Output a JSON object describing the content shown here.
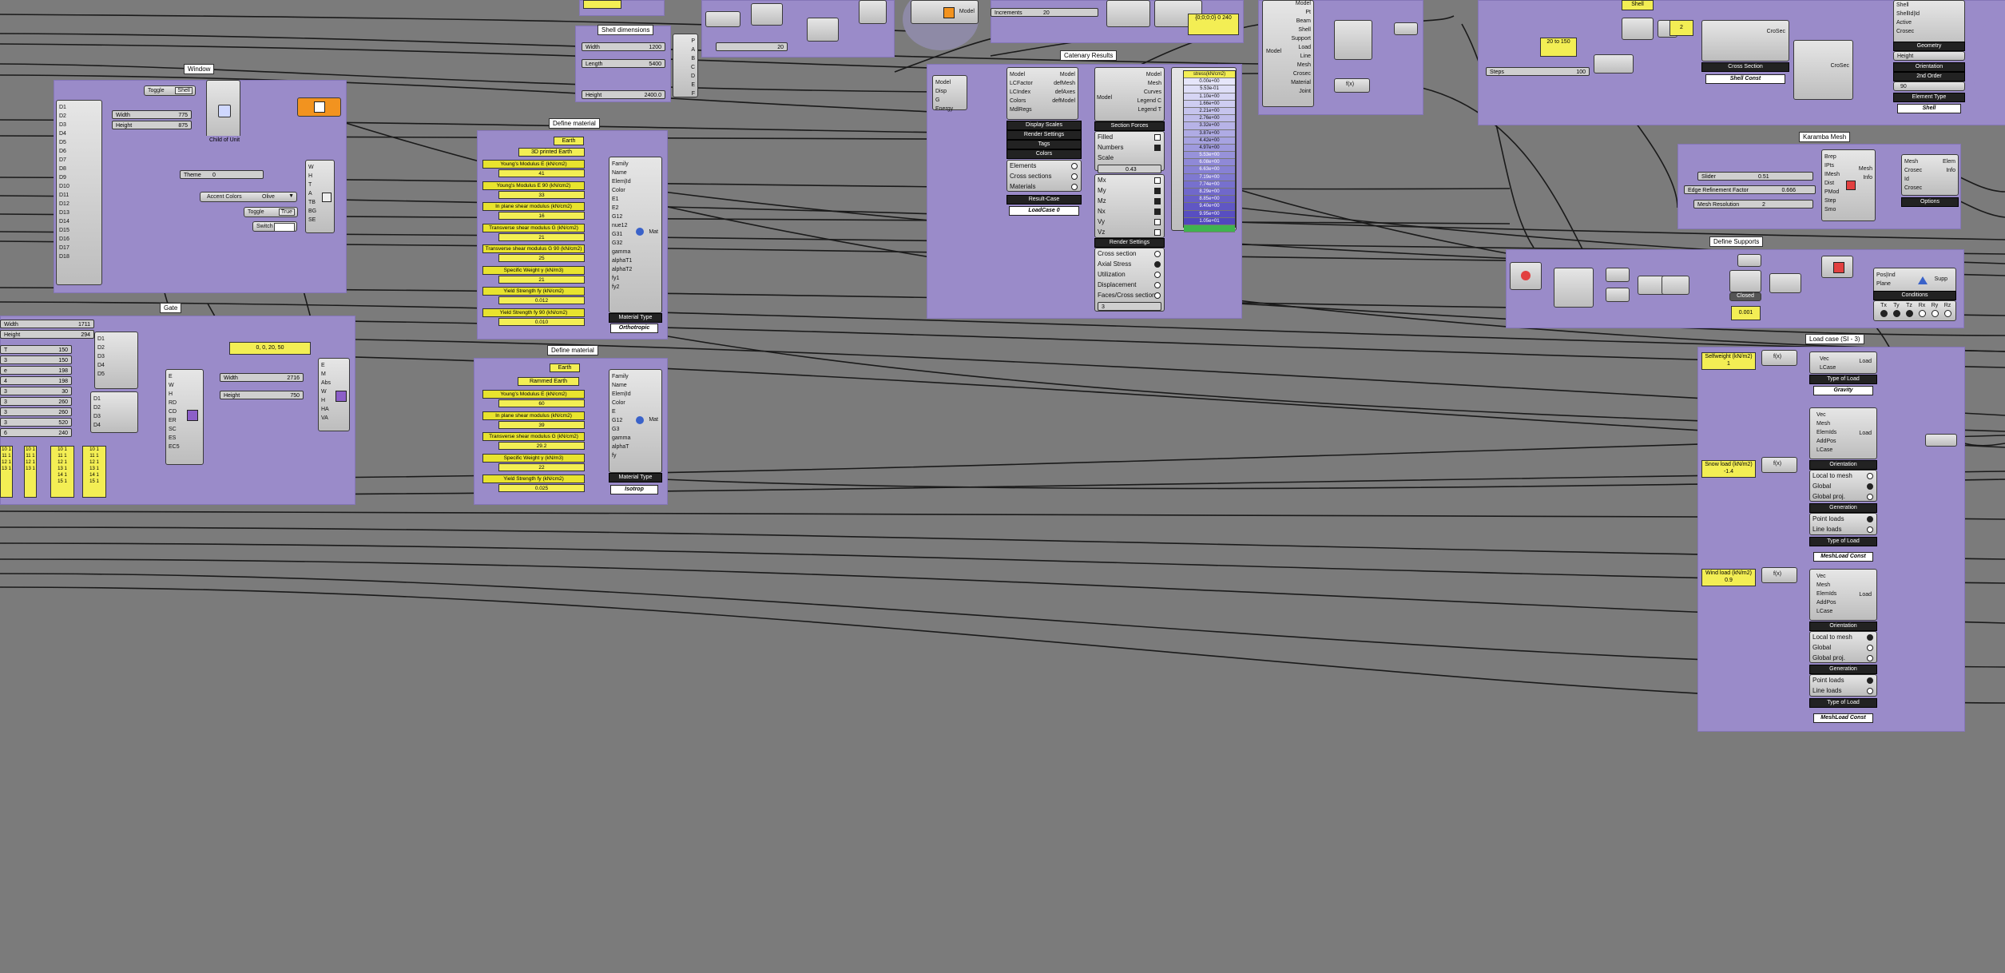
{
  "groups": {
    "window": "Window",
    "define_material_1": "Define material",
    "define_material_2": "Define material",
    "catenary_results": "Catenary Results",
    "karamba_mesh": "Karamba Mesh",
    "define_supports": "Define Supports",
    "load_case": "Load case (SI - 3)",
    "shell_dims": "Shell dimensions",
    "gate": "Gate"
  },
  "window_group": {
    "toggle": "Toggle",
    "toggle_value": "Shell",
    "width_label": "Width",
    "width_value": "775",
    "height_label": "Height",
    "height_value": "875",
    "child_label": "Child of Unit",
    "ports_left": [
      "D1",
      "D2",
      "D3",
      "D4",
      "D5",
      "D6",
      "D7",
      "D8",
      "D9",
      "D10",
      "D11",
      "D12",
      "D13",
      "D14",
      "D15",
      "D16",
      "D17",
      "D18"
    ],
    "theme_label": "Theme",
    "theme_value": "0",
    "accent_label": "Accent Colors",
    "accent_value": "Olive",
    "toggle2": "Toggle",
    "toggle2_value": "True",
    "switch_label": "Switch",
    "out_ports": [
      "W",
      "H",
      "T",
      "A",
      "TB",
      "BG",
      "SE"
    ]
  },
  "gate_group": {
    "width_label": "Width",
    "width_value": "1711",
    "height_label": "Height",
    "height_value": "294",
    "rows": [
      {
        "label": "T",
        "value": "150"
      },
      {
        "label": "3",
        "value": "150"
      },
      {
        "label": "e",
        "value": "198"
      },
      {
        "label": "4",
        "value": "198"
      },
      {
        "label": "3",
        "value": "30"
      },
      {
        "label": "3",
        "value": "260"
      },
      {
        "label": "3",
        "value": "260"
      },
      {
        "label": "3",
        "value": "520"
      },
      {
        "label": "6",
        "value": "240"
      }
    ],
    "ports": [
      "D1",
      "D2",
      "D3",
      "D4",
      "D5"
    ],
    "ports2": [
      "D1",
      "D2",
      "D3",
      "D4"
    ],
    "panel_value": "0, 0, 20, 50",
    "w2_label": "Width",
    "w2_value": "2716",
    "h2_label": "Height",
    "h2_value": "750",
    "out_ports": [
      "E",
      "W",
      "H",
      "RD",
      "CD",
      "ER",
      "SC",
      "ES",
      "EC5"
    ],
    "out2": [
      "E",
      "M",
      "Abs",
      "W",
      "H",
      "HA",
      "VA"
    ],
    "panels": [
      "10 1\n11 1\n12 1\n13 1",
      "10 1\n11 1\n12 1\n13 1",
      "10 1\n11 1\n12 1\n13 1\n14 1\n15 1",
      "10 1\n11 1\n12 1\n13 1\n14 1\n15 1"
    ]
  },
  "material1": {
    "family": "Earth",
    "name": "3D printed Earth",
    "labels": [
      "Young's Modulus E (kN/cm2)",
      "Young's Modulus E 90 (kN/cm2)",
      "In plane shear modulus (kN/cm2)",
      "Transverse shear modulus G (kN/cm2)",
      "Transverse shear modulus G 90 (kN/cm2)",
      "Specific Weight γ (kN/m3)",
      "Yield Strength fy (kN/cm2)",
      "Yield Strength fy 90 (kN/cm2)"
    ],
    "values": [
      "41",
      "33",
      "16",
      "21",
      "25",
      "21",
      "0.012",
      "0.010"
    ],
    "ports": [
      "Family",
      "Name",
      "Elem|Id",
      "Color",
      "E1",
      "E2",
      "G12",
      "nue12",
      "G31",
      "G32",
      "gamma",
      "alphaT1",
      "alphaT2",
      "fy1",
      "fy2"
    ],
    "out": "Mat",
    "type_label": "Material Type",
    "type_value": "Orthotropic"
  },
  "material2": {
    "family": "Earth",
    "name": "Rammed Earth",
    "labels": [
      "Young's Modulus E (kN/cm2)",
      "In plane shear modulus (kN/cm2)",
      "Transverse shear modulus G (kN/cm2)",
      "Specific Weight γ (kN/m3)",
      "Yield Strength fy (kN/cm2)"
    ],
    "values": [
      "60",
      "39",
      "29.2",
      "22",
      "0.025"
    ],
    "ports": [
      "Family",
      "Name",
      "Elem|Id",
      "Color",
      "E",
      "G12",
      "G3",
      "gamma",
      "alphaT",
      "fy"
    ],
    "out": "Mat",
    "type_label": "Material Type",
    "type_value": "Isotrop"
  },
  "shell_dims": {
    "width_label": "Width",
    "width_value": "1200",
    "length_label": "Length",
    "length_value": "5400",
    "height_label": "Height",
    "height_value": "2400.0",
    "slider_20": "20",
    "out_ports": [
      "P",
      "A",
      "B",
      "C",
      "D",
      "E",
      "F"
    ]
  },
  "catenary": {
    "model_ports_in": [
      "Model",
      "Disp",
      "G",
      "Energy"
    ],
    "comp2_in": [
      "Model",
      "LCFactor",
      "LCIndex",
      "Colors",
      "MdlRegs"
    ],
    "comp2_out": [
      "Model",
      "defMesh",
      "defAxes",
      "defModel"
    ],
    "comp3_in": [
      "Model",
      "Mesh",
      "Curves",
      "Legend C",
      "Legend T"
    ],
    "bars": [
      "Display Scales",
      "Render Settings",
      "Tags",
      "Colors"
    ],
    "opts": [
      "Elements",
      "Cross sections",
      "Materials"
    ],
    "result_case": "Result-Case",
    "loadcase": "LoadCase 0",
    "section_forces": "Section Forces",
    "filled": "Filled",
    "numbers": "Numbers",
    "scale": "Scale",
    "scale_value": "0.43",
    "forces": [
      "Mx",
      "My",
      "Mz",
      "Nx",
      "Vy",
      "Vz"
    ],
    "render_settings": "Render Settings",
    "render_opts": [
      "Cross section",
      "Axial Stress",
      "Utilization",
      "Displacement",
      "Faces/Cross section"
    ],
    "slider3": "3",
    "legend_title": "stress(kN/cm2)",
    "legend": [
      "0.00e+00",
      "5.53e-01",
      "1.10e+00",
      "1.66e+00",
      "2.21e+00",
      "2.76e+00",
      "3.32e+00",
      "3.87e+00",
      "4.42e+00",
      "4.97e+00",
      "5.53e+00",
      "6.08e+00",
      "6.63e+00",
      "7.19e+00",
      "7.74e+00",
      "8.29e+00",
      "8.85e+00",
      "9.40e+00",
      "9.95e+00",
      "1.05e+01"
    ]
  },
  "top": {
    "panel_shell": "Shell",
    "panel_2": "2",
    "panel_20to150": "20 to 150",
    "increments_label": "Increments",
    "increments_value": "20",
    "steps_label": "Steps",
    "steps_value": "100",
    "model_label": "Model",
    "top_panel": "{0;0;0;0}\n0 240",
    "analyze_ports": [
      "Model",
      "Pt",
      "Beam",
      "Shell",
      "Support",
      "Load",
      "Line",
      "Mesh",
      "Crosec",
      "Material",
      "Joint"
    ],
    "cross_section": "Cross Section",
    "cs_value": "Shell Const",
    "crossec_ports": [
      "Family",
      "Name",
      "Elem|Id",
      "Color",
      "Material",
      "Height"
    ],
    "out_crosec": "CroSec",
    "shell_ports": [
      "Shell",
      "ShellId|Id",
      "Active",
      "Crosec"
    ],
    "geometry": "Geometry",
    "height": "Height",
    "orientation": "Orientation",
    "order": "2nd Order",
    "element_type": "Element Type",
    "et_value": "Shell",
    "f_label": "F",
    "rotation_label": "90"
  },
  "mesh": {
    "slider1_label": "Slider",
    "slider1_value": "0.51",
    "edge_label": "Edge Refinement Factor",
    "edge_value": "0.666",
    "res_label": "Mesh Resolution",
    "res_value": "2",
    "ports": [
      "Brep",
      "IPts",
      "IMesh",
      "Dist",
      "PMod",
      "Step",
      "Smo"
    ],
    "out": [
      "Mesh",
      "Info"
    ],
    "shell_ports": [
      "Mesh",
      "Crosec",
      "Id",
      "Crosec"
    ],
    "out2": [
      "Elem",
      "Info"
    ],
    "options": "Options"
  },
  "supports": {
    "panel": "0.001",
    "closed": "Closed",
    "ports": [
      "Pos|Ind",
      "Plane"
    ],
    "conditions": "Conditions",
    "cond_labels": [
      "Tx",
      "Ty",
      "Tz",
      "Rx",
      "Ry",
      "Rz"
    ],
    "out": "Supp"
  },
  "loads": {
    "selfweight_label": "Selfweight (kN/m2)",
    "selfweight_value": "1",
    "snow_label": "Snow load (kN/m2)",
    "snow_value": "-1.4",
    "wind_label": "Wind load (kN/m2)",
    "wind_value": "0.9",
    "gravity_in": [
      "Vec",
      "LCase"
    ],
    "gravity_out": "Load",
    "type_of_load": "Type of Load",
    "gravity": "Gravity",
    "mesh_ports": [
      "Vec",
      "Mesh",
      "ElemIds",
      "AddPos",
      "LCase"
    ],
    "orientation": "Orientation",
    "orient_opts": [
      "Local to mesh",
      "Global",
      "Global proj."
    ],
    "generation": "Generation",
    "gen_opts": [
      "Point loads",
      "Line loads"
    ],
    "mesh_const": "MeshLoad Const",
    "fx_label": "f(x)"
  }
}
